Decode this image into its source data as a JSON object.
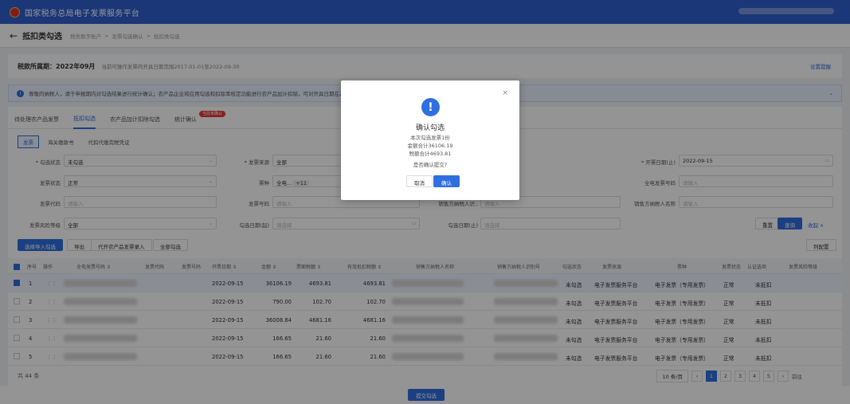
{
  "app": {
    "title": "国家税务总局电子发票服务平台"
  },
  "breadcrumb": {
    "page": "抵扣类勾选",
    "path": [
      "税务数字账户",
      "发票勾选确认",
      "抵扣类勾选"
    ]
  },
  "period": {
    "label": "税款所属期：2022年09月",
    "desc": "当前可操作发票的开具日期范围2017-01-01至2022-09-30",
    "help": "设置提醒"
  },
  "notice": {
    "text": "尊敬的纳税人，请于申报期内对勾选结果进行统计确认；农产品企业将应用勾选和扣除率核定功能进行农产品加计扣除，可对开具日期在2022年..."
  },
  "tabs": [
    "待处理农产品发票",
    "抵扣勾选",
    "农产品加计扣除勾选",
    "统计确认"
  ],
  "tab_badge": "当前未确认",
  "subtabs": [
    "发票",
    "海关缴款书",
    "代扣代缴完税凭证"
  ],
  "filters": {
    "check_status": {
      "label": "* 勾选状态",
      "value": "未勾选"
    },
    "invoice_source": {
      "label": "* 发票来源",
      "value": "全部"
    },
    "issue_date_end": {
      "label": "* 开票日期(止)",
      "value": "2022-09-15"
    },
    "invoice_status": {
      "label": "发票状态",
      "value": "正常"
    },
    "ticket_type": {
      "label": "票种",
      "value": "全电...",
      "extra": "+11"
    },
    "full_invoice_no": {
      "label": "全电发票号码",
      "placeholder": "请输入"
    },
    "invoice_code": {
      "label": "发票代码",
      "placeholder": "请输入"
    },
    "invoice_no": {
      "label": "发票号码",
      "placeholder": "请输入"
    },
    "seller_id": {
      "label": "销售方纳税人识..",
      "placeholder": "请输入"
    },
    "seller_name": {
      "label": "销售方纳税人名称",
      "placeholder": "请输入"
    },
    "risk_level": {
      "label": "发票风险等级",
      "value": "全部"
    },
    "check_date_start": {
      "label": "勾选日期(起)",
      "placeholder": "请选择"
    },
    "check_date_end": {
      "label": "勾选日期(止)",
      "placeholder": "请选择"
    }
  },
  "actions": {
    "reset": "重置",
    "query": "查询",
    "collapse": "收起 ∧",
    "import": "选择导入勾选",
    "export": "导出",
    "agri": "代开农产品发票录入",
    "check_all": "全部勾选",
    "columns": "列配置"
  },
  "table": {
    "headers": [
      "序号",
      "操作",
      "全电发票号码 ⇕",
      "发票代码",
      "发票号码",
      "开票日期 ⇕",
      "金额 ⇕",
      "票面税额 ⇕",
      "有效抵扣税额 ⇕",
      "销售方纳税人名称",
      "销售方纳税人识别号",
      "勾选状态",
      "发票来源",
      "票种",
      "发票状态",
      "认证选项",
      "发票风险等级"
    ],
    "rows": [
      {
        "idx": "1",
        "date": "2022-09-15",
        "amount": "36106.19",
        "tax": "4693.81",
        "eff": "4693.81",
        "state": "未勾选",
        "source": "电子发票服务平台",
        "type": "电子发票（专用发票）",
        "status": "正常",
        "extra": "未抵扣",
        "selected": true
      },
      {
        "idx": "2",
        "date": "2022-09-15",
        "amount": "790.00",
        "tax": "102.70",
        "eff": "102.70",
        "state": "未勾选",
        "source": "电子发票服务平台",
        "type": "电子发票（专用发票）",
        "status": "正常",
        "extra": "未抵扣",
        "selected": false
      },
      {
        "idx": "3",
        "date": "2022-09-15",
        "amount": "36008.84",
        "tax": "4681.16",
        "eff": "4681.16",
        "state": "未勾选",
        "source": "电子发票服务平台",
        "type": "电子发票（专用发票）",
        "status": "正常",
        "extra": "未抵扣",
        "selected": false
      },
      {
        "idx": "4",
        "date": "2022-09-15",
        "amount": "166.65",
        "tax": "21.60",
        "eff": "21.60",
        "state": "未勾选",
        "source": "电子发票服务平台",
        "type": "电子发票（专用发票）",
        "status": "正常",
        "extra": "未抵扣",
        "selected": false
      },
      {
        "idx": "5",
        "date": "2022-09-15",
        "amount": "166.65",
        "tax": "21.60",
        "eff": "21.60",
        "state": "未勾选",
        "source": "电子发票服务平台",
        "type": "电子发票（专用发票）",
        "status": "正常",
        "extra": "未抵扣",
        "selected": false
      }
    ]
  },
  "footer": {
    "total": "共 44 条",
    "page_size": "10 条/页",
    "pages": [
      "1",
      "2",
      "3",
      "4",
      "5"
    ],
    "goto": "前往"
  },
  "submit": "提交勾选",
  "modal": {
    "title": "确认勾选",
    "line1": "本次勾选发票1份",
    "line2": "金额合计36106.19",
    "line3": "税额合计4693.81",
    "question": "是否确认提交?",
    "cancel": "取消",
    "confirm": "确认"
  }
}
